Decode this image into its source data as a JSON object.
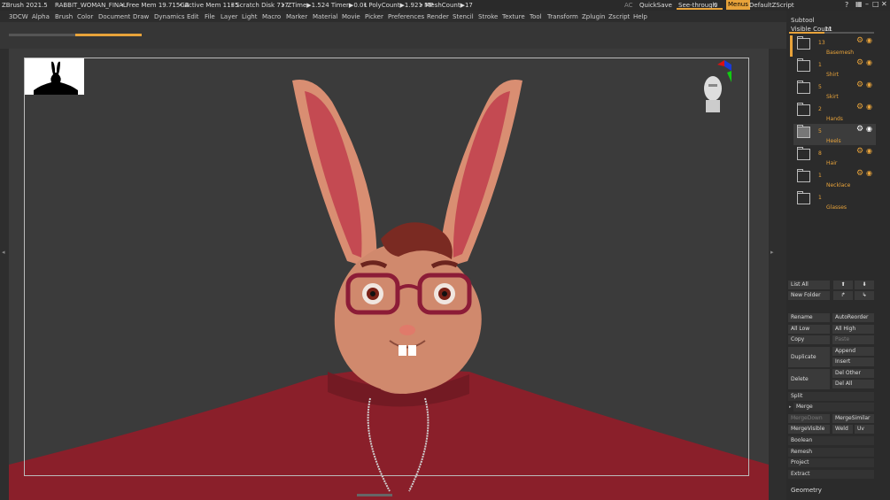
{
  "titlebar": {
    "app": "ZBrush 2021.5",
    "document": "RABBIT_WOMAN_FINAL",
    "free_mem": "• Free Mem 19.715GB",
    "active_mem": "• Active Mem 1135",
    "scratch": "• Scratch Disk 717",
    "ztime": "• ZTime▶1.524 Timer▶0.01",
    "polycount": "• PolyCount▶1.921 MP",
    "meshcount": "• MeshCount▶17",
    "ac": "AC",
    "quicksave": "QuickSave",
    "seethrough": "See-through",
    "seethrough_value": "0",
    "menus": "Menus",
    "zscript": "DefaultZScript"
  },
  "menu": [
    "3DCW",
    "Alpha",
    "Brush",
    "Color",
    "Document",
    "Draw",
    "Dynamics",
    "Edit",
    "File",
    "Layer",
    "Light",
    "Macro",
    "Marker",
    "Material",
    "Movie",
    "Picker",
    "Preferences",
    "Render",
    "Stencil",
    "Stroke",
    "Texture",
    "Tool",
    "Transform",
    "Zplugin",
    "Zscript",
    "Help"
  ],
  "subtool": {
    "title": "Subtool",
    "visible_label": "Visible Count",
    "visible_count": "11",
    "items": [
      {
        "count": "13",
        "name": "Basemesh"
      },
      {
        "count": "1",
        "name": "Shirt"
      },
      {
        "count": "5",
        "name": "Skirt"
      },
      {
        "count": "2",
        "name": "Hands"
      },
      {
        "count": "5",
        "name": "Heels"
      },
      {
        "count": "8",
        "name": "Hair"
      },
      {
        "count": "1",
        "name": "Necklace"
      },
      {
        "count": "1",
        "name": "Glasses"
      }
    ]
  },
  "buttons": {
    "list_all": "List All",
    "new_folder": "New Folder",
    "rename": "Rename",
    "auto_reorder": "AutoReorder",
    "all_low": "All Low",
    "all_high": "All High",
    "copy": "Copy",
    "paste": "Paste",
    "duplicate": "Duplicate",
    "append": "Append",
    "insert": "Insert",
    "delete": "Delete",
    "del_other": "Del Other",
    "del_all": "Del All",
    "split": "Split",
    "merge": "Merge",
    "merge_down": "MergeDown",
    "merge_similar": "MergeSimilar",
    "merge_visible": "MergeVisible",
    "weld": "Weld",
    "uv": "Uv",
    "boolean": "Boolean",
    "remesh": "Remesh",
    "project": "Project",
    "extract": "Extract",
    "geometry": "Geometry"
  }
}
